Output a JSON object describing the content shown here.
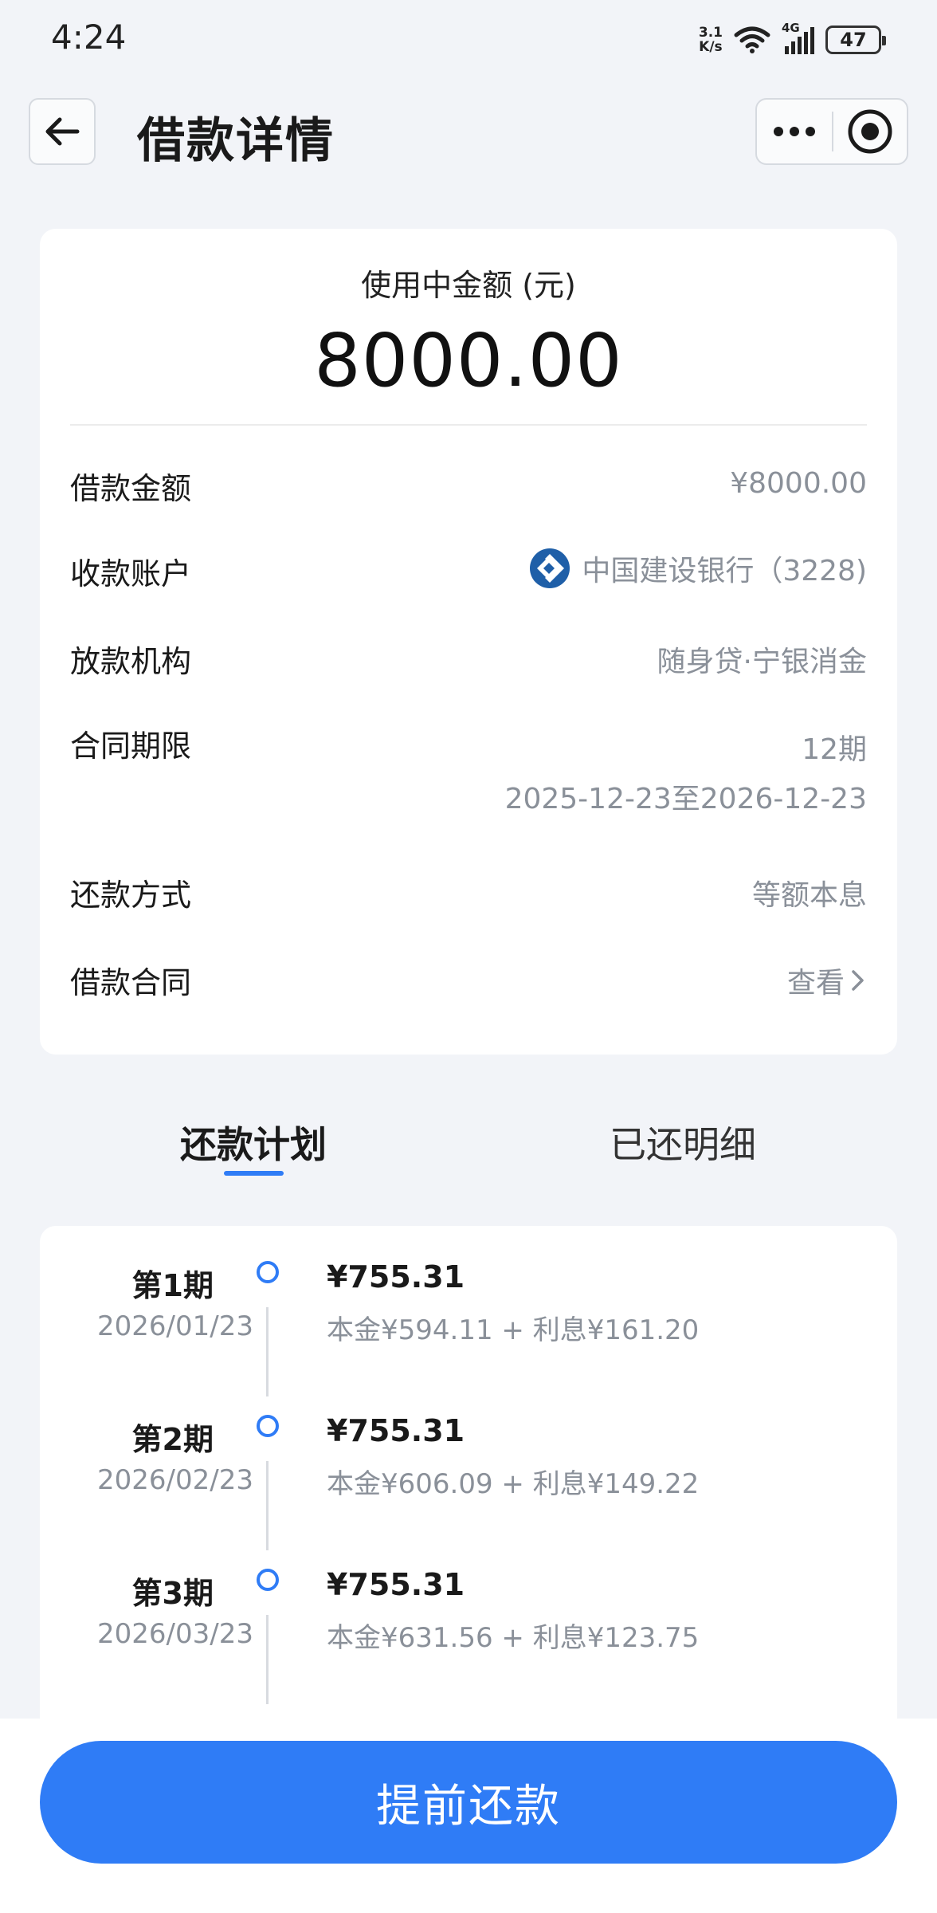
{
  "status_bar": {
    "time": "4:24",
    "net_speed_value": "3.1",
    "net_speed_unit": "K/s",
    "network_type": "4G",
    "battery": "47"
  },
  "header": {
    "title": "借款详情",
    "back_icon": "arrow-left-icon",
    "more_icon": "more-dots-icon",
    "close_icon": "target-close-icon"
  },
  "summary": {
    "used_label": "使用中金额 (元)",
    "used_amount": "8000.00"
  },
  "details": {
    "loan_amount_label": "借款金额",
    "loan_amount_value": "¥8000.00",
    "account_label": "收款账户",
    "account_value": "中国建设银行（3228)",
    "account_icon": "ccb-bank-logo",
    "lender_label": "放款机构",
    "lender_value": "随身贷·宁银消金",
    "term_label": "合同期限",
    "term_periods": "12期",
    "term_range": "2025-12-23至2026-12-23",
    "repay_method_label": "还款方式",
    "repay_method_value": "等额本息",
    "contract_label": "借款合同",
    "contract_link": "查看"
  },
  "tabs": [
    {
      "label": "还款计划",
      "active": true
    },
    {
      "label": "已还明细",
      "active": false
    }
  ],
  "plan": [
    {
      "period": "第1期",
      "date": "2026/01/23",
      "amount": "¥755.31",
      "detail": "本金¥594.11 + 利息¥161.20"
    },
    {
      "period": "第2期",
      "date": "2026/02/23",
      "amount": "¥755.31",
      "detail": "本金¥606.09 + 利息¥149.22"
    },
    {
      "period": "第3期",
      "date": "2026/03/23",
      "amount": "¥755.31",
      "detail": "本金¥631.56 + 利息¥123.75"
    }
  ],
  "actions": {
    "prepay_label": "提前还款"
  },
  "colors": {
    "accent": "#2f7cf6",
    "background": "#f2f4f8",
    "secondary_text": "#8a9099"
  }
}
